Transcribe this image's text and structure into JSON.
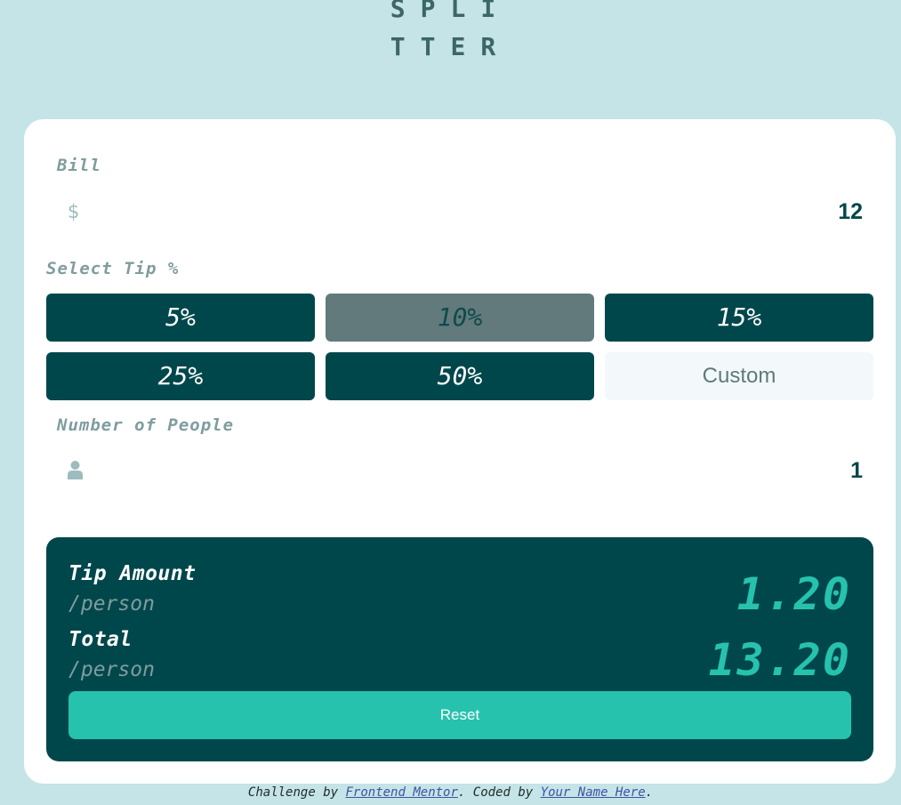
{
  "logo": {
    "line1": "SPLI",
    "line2": "TTER"
  },
  "bill": {
    "label": "Bill",
    "icon": "dollar-icon",
    "icon_glyph": "$",
    "value": "12"
  },
  "tip": {
    "label": "Select Tip %",
    "options": [
      "5%",
      "10%",
      "15%",
      "25%",
      "50%"
    ],
    "selected": "10%",
    "custom_placeholder": "Custom"
  },
  "people": {
    "label": "Number of People",
    "icon": "person-icon",
    "value": "1"
  },
  "results": {
    "tip_amount_title": "Tip Amount",
    "tip_amount_sub": "/person",
    "tip_amount_value": "1.20",
    "total_title": "Total",
    "total_sub": "/person",
    "total_value": "13.20",
    "reset_label": "Reset"
  },
  "attribution": {
    "prefix": "Challenge by ",
    "link1": "Frontend Mentor",
    "middle": ". Coded by ",
    "link2": "Your Name Here",
    "suffix": "."
  },
  "colors": {
    "background": "#c5e4e7",
    "dark_cyan": "#00474b",
    "strong_cyan": "#26c2ae",
    "grayish_cyan": "#7f9d9f",
    "selected_tip": "#627a7b"
  }
}
